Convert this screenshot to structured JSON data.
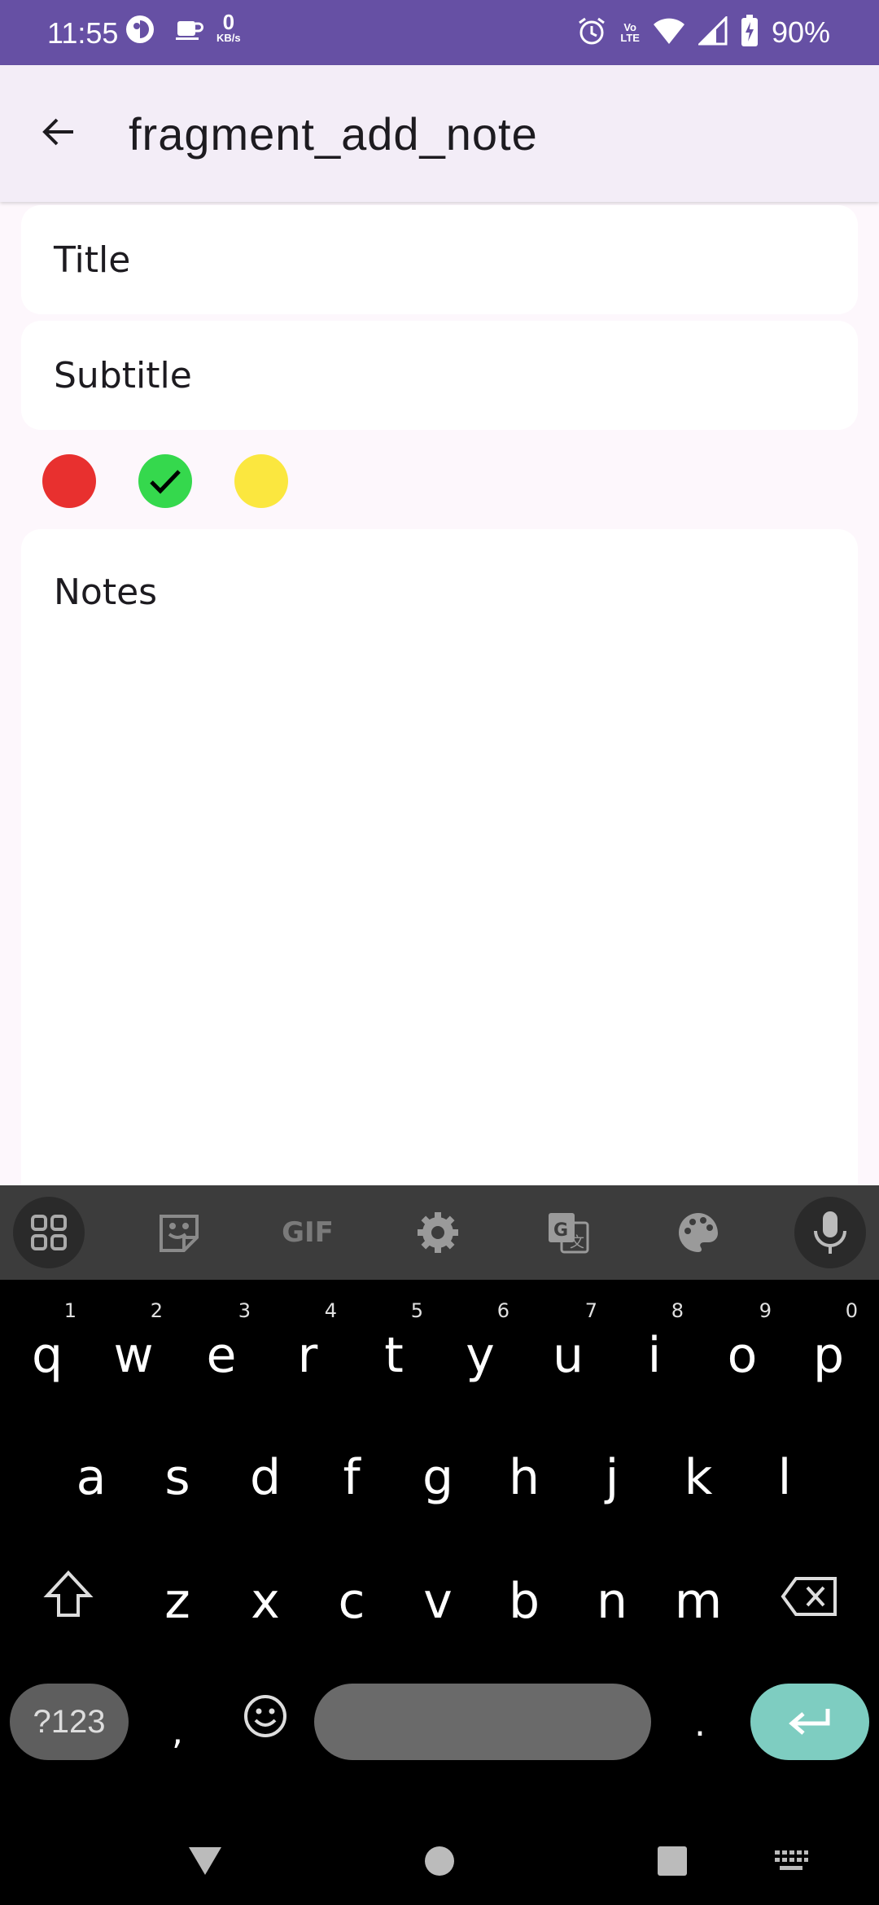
{
  "status_bar": {
    "time": "11:55",
    "speed_value": "0",
    "speed_unit": "KB/s",
    "volte_top": "Vo",
    "volte_bottom": "LTE",
    "battery": "90%",
    "icons": [
      "app-icon",
      "coffee-icon",
      "alarm-icon",
      "volte-icon",
      "wifi-icon",
      "signal-icon",
      "battery-charging-icon"
    ]
  },
  "app_bar": {
    "title": "fragment_add_note",
    "back_icon": "arrow-back-icon"
  },
  "form": {
    "title_placeholder": "Title",
    "subtitle_placeholder": "Subtitle",
    "notes_placeholder": "Notes",
    "colors": [
      {
        "name": "red",
        "hex": "#e8302f",
        "selected": false
      },
      {
        "name": "green",
        "hex": "#35d84d",
        "selected": true
      },
      {
        "name": "yellow",
        "hex": "#fbe73f",
        "selected": false
      }
    ]
  },
  "keyboard": {
    "toolbar": [
      "apps-grid-icon",
      "sticker-icon",
      "gif-icon",
      "settings-gear-icon",
      "translate-icon",
      "palette-icon",
      "mic-icon"
    ],
    "gif_label": "GIF",
    "row1": [
      {
        "k": "q",
        "h": "1"
      },
      {
        "k": "w",
        "h": "2"
      },
      {
        "k": "e",
        "h": "3"
      },
      {
        "k": "r",
        "h": "4"
      },
      {
        "k": "t",
        "h": "5"
      },
      {
        "k": "y",
        "h": "6"
      },
      {
        "k": "u",
        "h": "7"
      },
      {
        "k": "i",
        "h": "8"
      },
      {
        "k": "o",
        "h": "9"
      },
      {
        "k": "p",
        "h": "0"
      }
    ],
    "row2": [
      "a",
      "s",
      "d",
      "f",
      "g",
      "h",
      "j",
      "k",
      "l"
    ],
    "row3": [
      "z",
      "x",
      "c",
      "v",
      "b",
      "n",
      "m"
    ],
    "symbols_label": "?123",
    "comma": ",",
    "period": ".",
    "accent": "#7ecdc1"
  }
}
